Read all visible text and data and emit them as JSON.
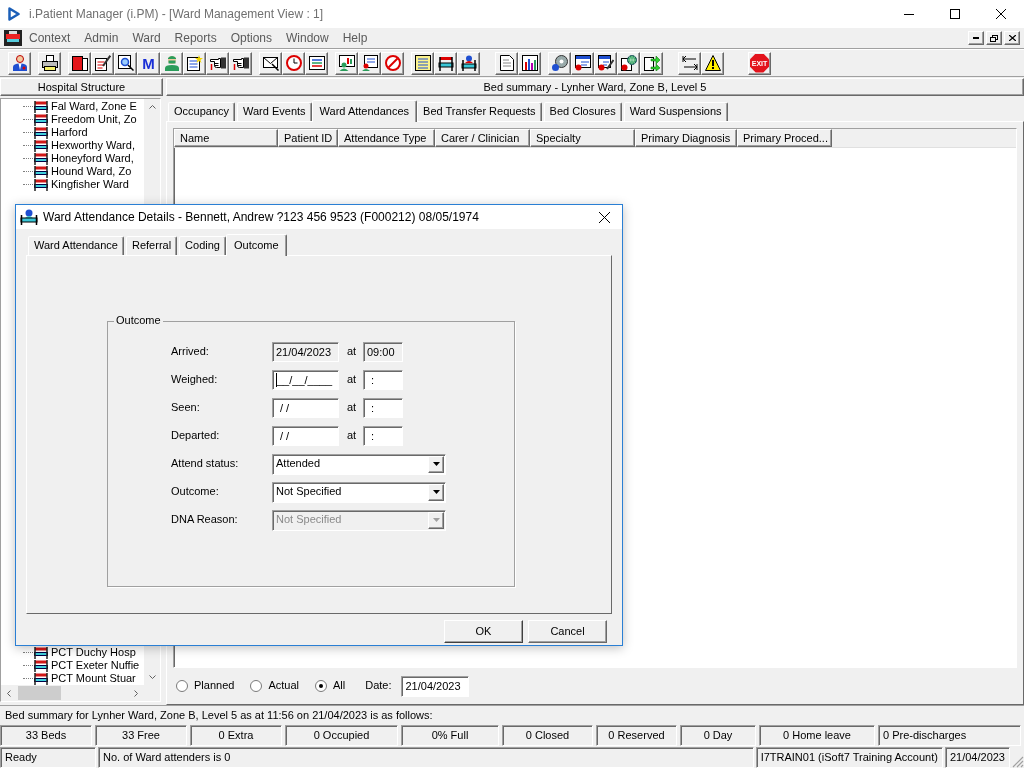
{
  "window": {
    "title": "i.Patient Manager (i.PM) - [Ward Management View : 1]"
  },
  "menu": [
    "Context",
    "Admin",
    "Ward",
    "Reports",
    "Options",
    "Window",
    "Help"
  ],
  "toolbar": {
    "letter_button": "M",
    "exit_button": "EXIT"
  },
  "hospital_structure": {
    "title": "Hospital Structure",
    "items_above": [
      {
        "label": "Fal Ward, Zone E",
        "selected": false
      },
      {
        "label": "Freedom Unit, Zo",
        "selected": false
      },
      {
        "label": "Harford",
        "selected": false
      },
      {
        "label": "Hexworthy Ward,",
        "selected": false
      },
      {
        "label": "Honeyford Ward,",
        "selected": false
      },
      {
        "label": "Hound Ward, Zo",
        "selected": false
      },
      {
        "label": "Kingfisher Ward",
        "selected": false
      }
    ],
    "items_below": [
      {
        "label": "PCT Duchy Hosp",
        "selected": false
      },
      {
        "label": "PCT Exeter Nuffie",
        "selected": false
      },
      {
        "label": "PCT Mount Stuar",
        "selected": false
      }
    ]
  },
  "ward_view": {
    "title": "Bed summary - Lynher Ward, Zone B, Level 5",
    "tabs": [
      {
        "label": "Occupancy",
        "selected": false
      },
      {
        "label": "Ward Events",
        "selected": false
      },
      {
        "label": "Ward Attendances",
        "selected": true
      },
      {
        "label": "Bed Transfer Requests",
        "selected": false
      },
      {
        "label": "Bed Closures",
        "selected": false
      },
      {
        "label": "Ward Suspensions",
        "selected": false
      }
    ],
    "columns": [
      "Name",
      "Patient ID",
      "Attendance Type",
      "Carer / Clinician",
      "Specialty",
      "Primary Diagnosis",
      "Primary Proced..."
    ],
    "filters": [
      {
        "label": "Planned",
        "selected": false
      },
      {
        "label": "Actual",
        "selected": false
      },
      {
        "label": "All",
        "selected": true
      }
    ],
    "date": {
      "label": "Date:",
      "value": "21/04/2023"
    }
  },
  "bed_summary": {
    "caption": "Bed summary for Lynher Ward, Zone B, Level 5 as at 11:56 on 21/04/2023 is as follows:",
    "counts": [
      "33 Beds",
      "33 Free",
      "0 Extra",
      "0 Occupied",
      "0% Full",
      "0 Closed",
      "0 Reserved",
      "0 Day",
      "0 Home leave",
      "0 Pre-discharges"
    ]
  },
  "status_bar": [
    "Ready",
    "No. of Ward attenders is 0",
    "I7TRAIN01 (iSoft7 Training Account)",
    "21/04/2023"
  ],
  "dialog": {
    "title": "Ward Attendance Details - Bennett, Andrew ?123 456 9523 (F000212) 08/05/1974",
    "tabs": [
      {
        "label": "Ward Attendance",
        "selected": false
      },
      {
        "label": "Referral",
        "selected": false
      },
      {
        "label": "Coding",
        "selected": false
      },
      {
        "label": "Outcome",
        "selected": true
      }
    ],
    "group_title": "Outcome",
    "date_rows": [
      {
        "label": "Arrived:",
        "date": "21/04/2023",
        "at": "at",
        "time": "09:00",
        "readonly": true,
        "focused": false
      },
      {
        "label": "Weighed:",
        "date": "__/__/____",
        "at": "at",
        "time": ":",
        "readonly": false,
        "focused": true
      },
      {
        "label": "Seen:",
        "date": "/ /",
        "at": "at",
        "time": ":",
        "readonly": false,
        "focused": false
      },
      {
        "label": "Departed:",
        "date": "/ /",
        "at": "at",
        "time": ":",
        "readonly": false,
        "focused": false
      }
    ],
    "select_rows": [
      {
        "label": "Attend status:",
        "value": "Attended",
        "disabled": false
      },
      {
        "label": "Outcome:",
        "value": "Not Specified",
        "disabled": false
      },
      {
        "label": "DNA Reason:",
        "value": "Not Specified",
        "disabled": true
      }
    ],
    "buttons": [
      "OK",
      "Cancel"
    ]
  }
}
